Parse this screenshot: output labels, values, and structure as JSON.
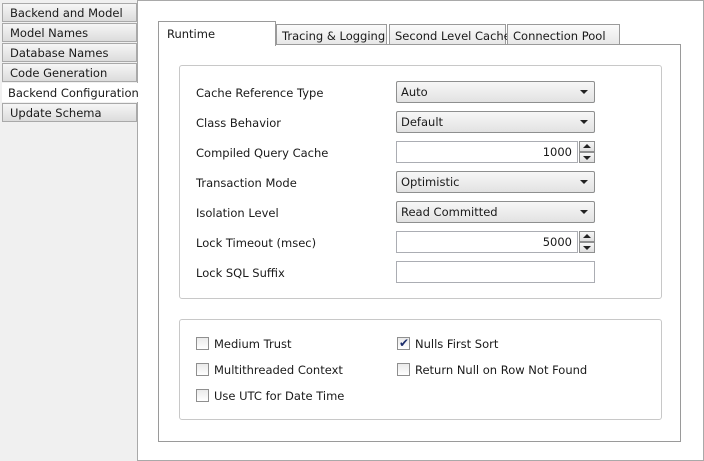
{
  "sidebar": {
    "items": [
      {
        "label": "Backend and Model"
      },
      {
        "label": "Model Names"
      },
      {
        "label": "Database Names"
      },
      {
        "label": "Code Generation"
      },
      {
        "label": "Backend Configuration"
      },
      {
        "label": "Update Schema"
      }
    ],
    "selected": "Backend Configuration"
  },
  "tabs": [
    {
      "label": "Runtime"
    },
    {
      "label": "Tracing & Logging"
    },
    {
      "label": "Second Level Cache"
    },
    {
      "label": "Connection Pool"
    }
  ],
  "runtime": {
    "cache_reference_type": {
      "label": "Cache Reference Type",
      "value": "Auto"
    },
    "class_behavior": {
      "label": "Class Behavior",
      "value": "Default"
    },
    "compiled_query_cache": {
      "label": "Compiled Query Cache",
      "value": "1000"
    },
    "transaction_mode": {
      "label": "Transaction Mode",
      "value": "Optimistic"
    },
    "isolation_level": {
      "label": "Isolation Level",
      "value": "Read Committed"
    },
    "lock_timeout": {
      "label": "Lock Timeout (msec)",
      "value": "5000"
    },
    "lock_sql_suffix": {
      "label": "Lock SQL Suffix",
      "value": ""
    }
  },
  "options": {
    "medium_trust": {
      "label": "Medium Trust",
      "checked": false
    },
    "multithreaded_context": {
      "label": "Multithreaded Context",
      "checked": false
    },
    "use_utc": {
      "label": "Use UTC for Date Time",
      "checked": false
    },
    "nulls_first_sort": {
      "label": "Nulls First Sort",
      "checked": true
    },
    "return_null": {
      "label": "Return Null on Row Not Found",
      "checked": false
    }
  },
  "glyphs": {
    "check": "✔"
  }
}
